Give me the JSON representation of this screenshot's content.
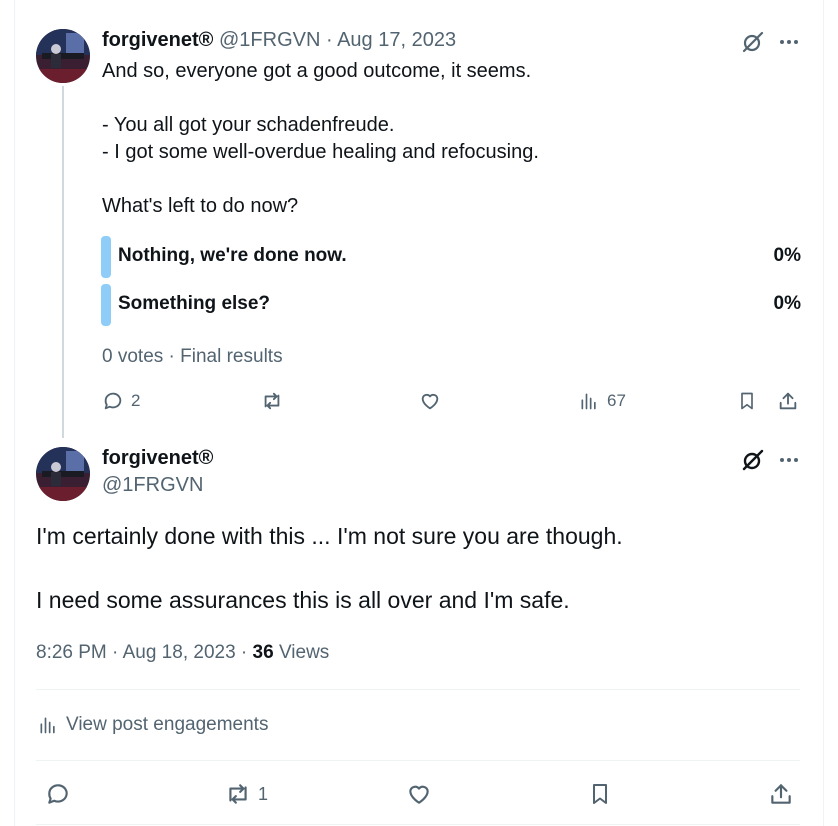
{
  "first_post": {
    "author_name": "forgivenet®",
    "handle_date": "@1FRGVN · Aug 17, 2023",
    "text_lines": [
      "And so, everyone got a good outcome, it seems.",
      "- You all got your schadenfreude.",
      "- I got some well-overdue healing and refocusing.",
      "What's left to do now?"
    ],
    "poll": {
      "options": [
        {
          "label": "Nothing, we're done now.",
          "percent": "0%"
        },
        {
          "label": "Something else?",
          "percent": "0%"
        }
      ],
      "summary": "0 votes · Final results"
    },
    "actions": {
      "replies": "2",
      "reposts": "",
      "likes": "",
      "views": "67"
    },
    "icons": [
      "grok-icon",
      "more-icon",
      "reply-icon",
      "repost-icon",
      "like-icon",
      "views-icon",
      "bookmark-icon",
      "share-icon"
    ]
  },
  "main_post": {
    "author_name": "forgivenet®",
    "handle": "@1FRGVN",
    "text_lines": [
      "I'm certainly done with this ... I'm not sure you are though.",
      "I need some assurances this is all over and I'm safe."
    ],
    "timestamp": "8:26 PM · Aug 18, 2023 · ",
    "views_count": "36",
    "views_label": " Views",
    "engagements_label": "View post engagements",
    "actions": {
      "replies": "",
      "reposts": "1",
      "likes": ""
    }
  },
  "colors": {
    "text": "#0f1419",
    "muted": "#536471",
    "poll_bar": "#8ecdf8",
    "divider": "#eff3f4",
    "thread_line": "#cfd9de"
  }
}
